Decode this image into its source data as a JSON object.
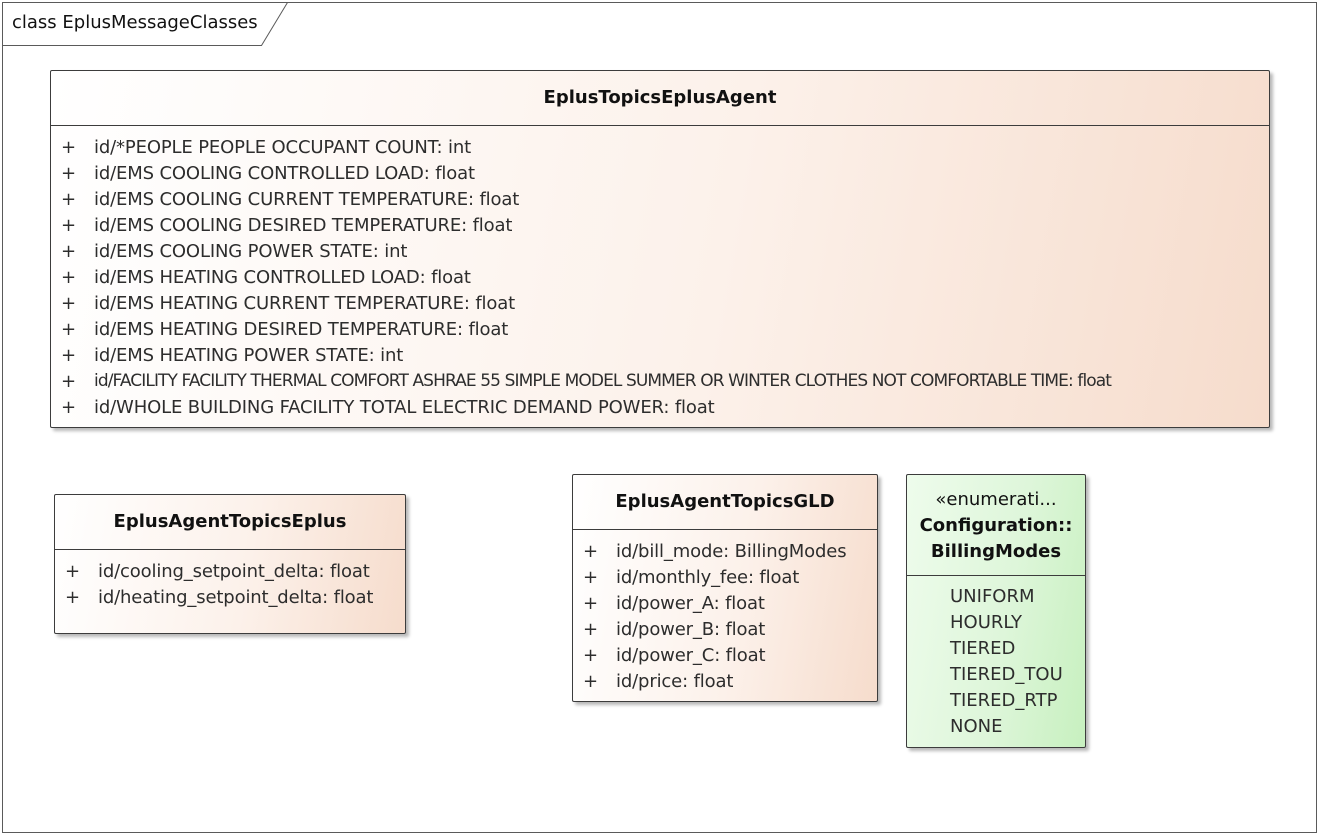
{
  "frame": {
    "title": "class EplusMessageClasses"
  },
  "classes": [
    {
      "name": "EplusTopicsEplusAgent",
      "attributes": [
        {
          "visibility": "+",
          "text": "id/*PEOPLE PEOPLE OCCUPANT COUNT: int"
        },
        {
          "visibility": "+",
          "text": "id/EMS COOLING CONTROLLED LOAD: float"
        },
        {
          "visibility": "+",
          "text": "id/EMS COOLING CURRENT TEMPERATURE: float"
        },
        {
          "visibility": "+",
          "text": "id/EMS COOLING DESIRED TEMPERATURE: float"
        },
        {
          "visibility": "+",
          "text": "id/EMS COOLING POWER STATE: int"
        },
        {
          "visibility": "+",
          "text": "id/EMS HEATING CONTROLLED LOAD: float"
        },
        {
          "visibility": "+",
          "text": "id/EMS HEATING CURRENT TEMPERATURE: float"
        },
        {
          "visibility": "+",
          "text": "id/EMS HEATING DESIRED TEMPERATURE: float"
        },
        {
          "visibility": "+",
          "text": "id/EMS HEATING POWER STATE: int"
        },
        {
          "visibility": "+",
          "text": "id/FACILITY FACILITY THERMAL COMFORT ASHRAE 55 SIMPLE MODEL SUMMER OR WINTER CLOTHES NOT COMFORTABLE TIME: float"
        },
        {
          "visibility": "+",
          "text": "id/WHOLE BUILDING FACILITY TOTAL ELECTRIC DEMAND POWER: float"
        }
      ]
    },
    {
      "name": "EplusAgentTopicsEplus",
      "attributes": [
        {
          "visibility": "+",
          "text": "id/cooling_setpoint_delta: float"
        },
        {
          "visibility": "+",
          "text": "id/heating_setpoint_delta: float"
        }
      ]
    },
    {
      "name": "EplusAgentTopicsGLD",
      "attributes": [
        {
          "visibility": "+",
          "text": "id/bill_mode: BillingModes"
        },
        {
          "visibility": "+",
          "text": "id/monthly_fee: float"
        },
        {
          "visibility": "+",
          "text": "id/power_A: float"
        },
        {
          "visibility": "+",
          "text": "id/power_B: float"
        },
        {
          "visibility": "+",
          "text": "id/power_C: float"
        },
        {
          "visibility": "+",
          "text": "id/price: float"
        }
      ]
    }
  ],
  "enumeration": {
    "stereotype": "«enumerati...",
    "name_line1": "Configuration::",
    "name_line2": "BillingModes",
    "literals": [
      "UNIFORM",
      "HOURLY",
      "TIERED",
      "TIERED_TOU",
      "TIERED_RTP",
      "NONE"
    ]
  },
  "colors": {
    "class_fill": "#f6dccc",
    "enum_fill": "#c7f0bf",
    "border": "#3c3c3c"
  }
}
